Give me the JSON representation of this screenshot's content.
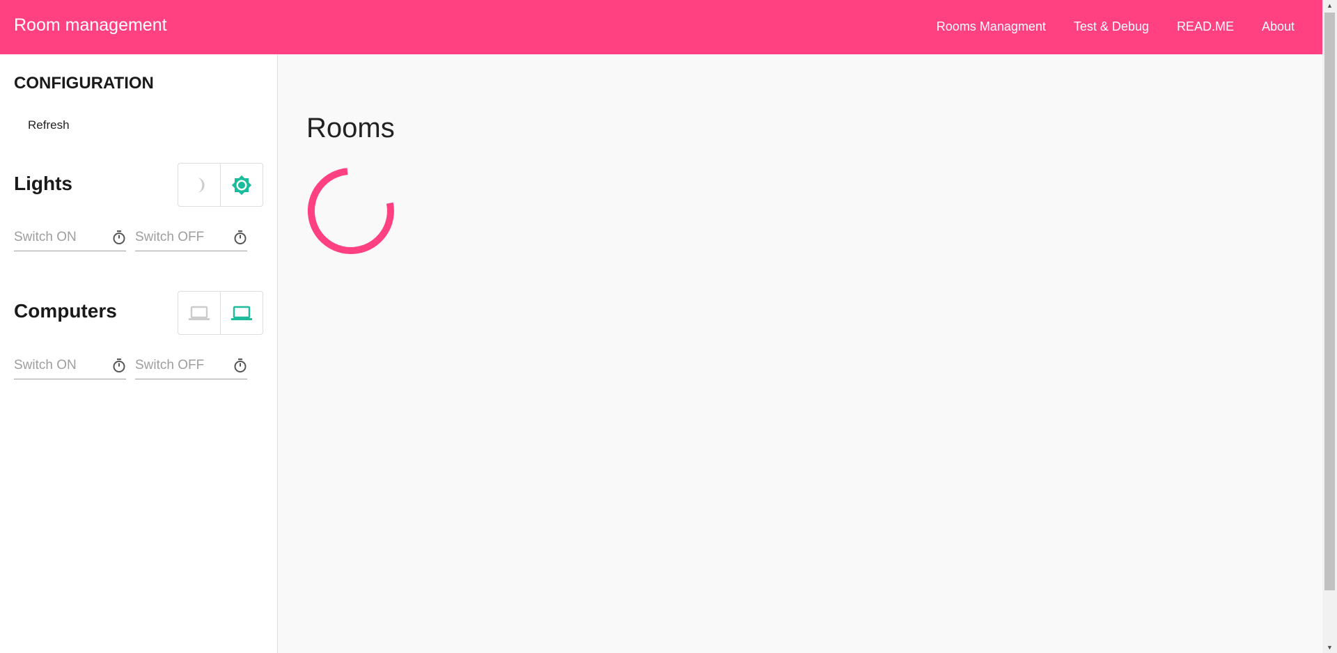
{
  "navbar": {
    "brand": "Room management",
    "links": [
      "Rooms Managment",
      "Test & Debug",
      "READ.ME",
      "About"
    ]
  },
  "sidebar": {
    "title": "CONFIGURATION",
    "refresh_label": "Refresh",
    "lights": {
      "title": "Lights",
      "switch_on_placeholder": "Switch ON",
      "switch_off_placeholder": "Switch OFF",
      "off_icon": "moon-icon",
      "on_icon": "brightness-icon"
    },
    "computers": {
      "title": "Computers",
      "switch_on_placeholder": "Switch ON",
      "switch_off_placeholder": "Switch OFF",
      "off_icon": "laptop-off-icon",
      "on_icon": "laptop-on-icon"
    }
  },
  "main": {
    "title": "Rooms"
  },
  "colors": {
    "accent": "#ff4081",
    "active_icon": "#1abc9c",
    "inactive_icon": "#cccccc"
  }
}
